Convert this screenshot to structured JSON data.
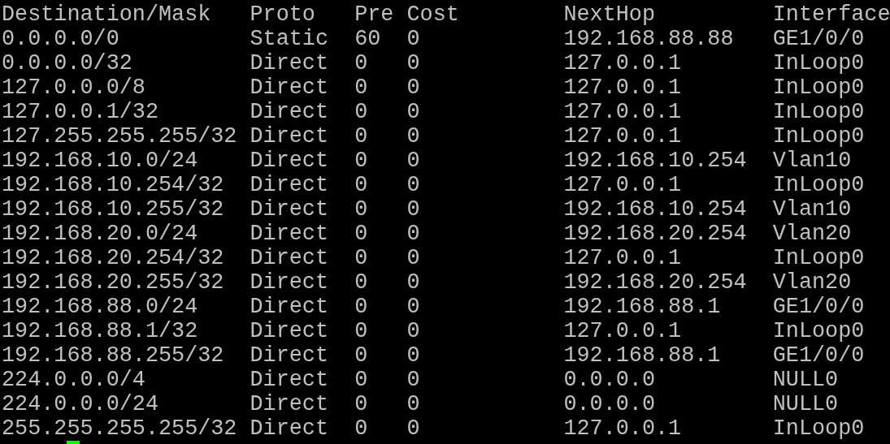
{
  "table": {
    "columns": [
      "Destination/Mask",
      "Proto",
      "Pre",
      "Cost",
      "NextHop",
      "Interface"
    ],
    "rows": [
      [
        "0.0.0.0/0",
        "Static",
        "60",
        "0",
        "192.168.88.88",
        "GE1/0/0"
      ],
      [
        "0.0.0.0/32",
        "Direct",
        "0",
        "0",
        "127.0.0.1",
        "InLoop0"
      ],
      [
        "127.0.0.0/8",
        "Direct",
        "0",
        "0",
        "127.0.0.1",
        "InLoop0"
      ],
      [
        "127.0.0.1/32",
        "Direct",
        "0",
        "0",
        "127.0.0.1",
        "InLoop0"
      ],
      [
        "127.255.255.255/32",
        "Direct",
        "0",
        "0",
        "127.0.0.1",
        "InLoop0"
      ],
      [
        "192.168.10.0/24",
        "Direct",
        "0",
        "0",
        "192.168.10.254",
        "Vlan10"
      ],
      [
        "192.168.10.254/32",
        "Direct",
        "0",
        "0",
        "127.0.0.1",
        "InLoop0"
      ],
      [
        "192.168.10.255/32",
        "Direct",
        "0",
        "0",
        "192.168.10.254",
        "Vlan10"
      ],
      [
        "192.168.20.0/24",
        "Direct",
        "0",
        "0",
        "192.168.20.254",
        "Vlan20"
      ],
      [
        "192.168.20.254/32",
        "Direct",
        "0",
        "0",
        "127.0.0.1",
        "InLoop0"
      ],
      [
        "192.168.20.255/32",
        "Direct",
        "0",
        "0",
        "192.168.20.254",
        "Vlan20"
      ],
      [
        "192.168.88.0/24",
        "Direct",
        "0",
        "0",
        "192.168.88.1",
        "GE1/0/0"
      ],
      [
        "192.168.88.1/32",
        "Direct",
        "0",
        "0",
        "127.0.0.1",
        "InLoop0"
      ],
      [
        "192.168.88.255/32",
        "Direct",
        "0",
        "0",
        "192.168.88.1",
        "GE1/0/0"
      ],
      [
        "224.0.0.0/4",
        "Direct",
        "0",
        "0",
        "0.0.0.0",
        "NULL0"
      ],
      [
        "224.0.0.0/24",
        "Direct",
        "0",
        "0",
        "0.0.0.0",
        "NULL0"
      ],
      [
        "255.255.255.255/32",
        "Direct",
        "0",
        "0",
        "127.0.0.1",
        "InLoop0"
      ]
    ]
  }
}
